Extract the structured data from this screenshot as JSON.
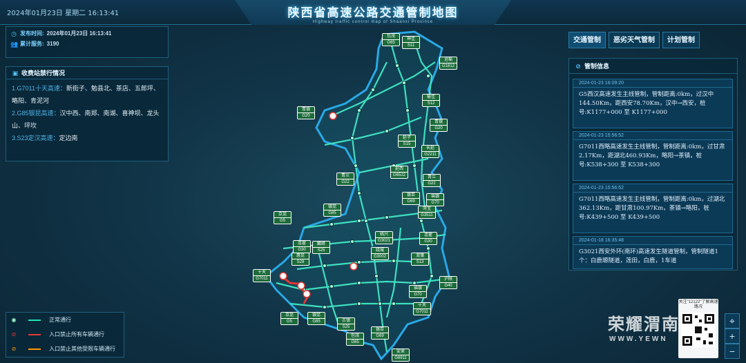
{
  "header": {
    "datetime": "2024年01月23日 星期二  16:13:41",
    "title": "陕西省高速公路交通管制地图",
    "subtitle": "Highway traffic control map of Shaanxi Province"
  },
  "info": {
    "publish_label": "发布时间:",
    "publish_value": "2024年01月23日  16:13:41",
    "service_label": "累计服务:",
    "service_value": "3190"
  },
  "toll": {
    "title": "收费站禁行情况",
    "items": [
      {
        "route": "1.G7011十天高速：",
        "text": "新街子、勉县北、茶店、五郎坪、略阳、青泥河"
      },
      {
        "route": "2.G85银昆高速：",
        "text": "汉中西、南郑、南湖、喜神坝、龙头山、坪坎"
      },
      {
        "route": "3.S23定汉高速：",
        "text": "定边南"
      }
    ]
  },
  "tabs": [
    "交通管制",
    "恶劣天气管制",
    "计划管制"
  ],
  "control": {
    "title": "管制信息",
    "notices": [
      {
        "time": "2024-01-23 16:09:20",
        "body": "G5西汉高速发生主线管制，管制距离:0km，过汉中144.50Km，距西安78.70Km，汉中→西安，桩号:K1177+000 至 K1177+000"
      },
      {
        "time": "2024-01-23 15:56:52",
        "body": "G7011西略高速发生主线管制，管制距离:0km，过甘肃2.17Km，距湖北460.93Km，略阳→茶镇，桩号:K538+300 至 K538+300"
      },
      {
        "time": "2024-01-23 15:56:52",
        "body": "G7011西略高速发生主线管制，管制距离:0km，过湖北362.13Km，距甘肃100.97Km，茶镇→略阳，桩号:K439+500 至 K439+500"
      },
      {
        "time": "2024-01-18 16:35:48",
        "body": "G3021西安外环(南环)高速发生隧道管制，管制隧道1个：白鹿塬隧道，莲田，白鹿，1车道"
      }
    ]
  },
  "legend": [
    {
      "label": "正常通行",
      "color": "#1de9b6"
    },
    {
      "label": "入口禁止所有车辆通行",
      "color": "#e53935"
    },
    {
      "label": "入口禁止其他受限车辆通行",
      "color": "#ff9800"
    }
  ],
  "badges": [
    {
      "t": "包茂",
      "b": "G65"
    },
    {
      "t": "神佳",
      "b": "S11"
    },
    {
      "t": "沧榆",
      "b": "G1812"
    },
    {
      "t": "青银",
      "b": "G20"
    },
    {
      "t": "榆佳",
      "b": "S12"
    },
    {
      "t": "青银",
      "b": "G20"
    },
    {
      "t": "延子",
      "b": "S15"
    },
    {
      "t": "长延",
      "b": "G2211"
    },
    {
      "t": "青兰",
      "b": "G22"
    },
    {
      "t": "延西",
      "b": "G6522"
    },
    {
      "t": "青兰",
      "b": "G22"
    },
    {
      "t": "银百",
      "b": "G69"
    },
    {
      "t": "福银",
      "b": "G70"
    },
    {
      "t": "银昆",
      "b": "G85"
    },
    {
      "t": "京昆",
      "b": "G5"
    },
    {
      "t": "菏宝",
      "b": "G3511"
    },
    {
      "t": "临兴",
      "b": "G3021"
    },
    {
      "t": "连霍",
      "b": "G30"
    },
    {
      "t": "连霍",
      "b": "G30"
    },
    {
      "t": "麟绛",
      "b": "S25"
    },
    {
      "t": "惠昆",
      "b": "S28"
    },
    {
      "t": "绕城",
      "b": "G3002"
    },
    {
      "t": "渭蒲",
      "b": "S13"
    },
    {
      "t": "十天",
      "b": "G7011"
    },
    {
      "t": "沪陕",
      "b": "G40"
    },
    {
      "t": "福银",
      "b": "G70"
    },
    {
      "t": "十天",
      "b": "G7011"
    },
    {
      "t": "京昆",
      "b": "G5"
    },
    {
      "t": "银昆",
      "b": "G85"
    },
    {
      "t": "古镇",
      "b": "S25"
    },
    {
      "t": "包茂",
      "b": "G65"
    },
    {
      "t": "银百",
      "b": "G69"
    },
    {
      "t": "安来",
      "b": "G6911"
    }
  ],
  "qr": {
    "caption": "关注\"12122\"了解高速路况"
  },
  "watermark": {
    "name": "荣耀渭南",
    "url": "WWW.YEWN"
  },
  "controls": {
    "locate": "⌖",
    "zoom_in": "+",
    "zoom_out": "−"
  }
}
